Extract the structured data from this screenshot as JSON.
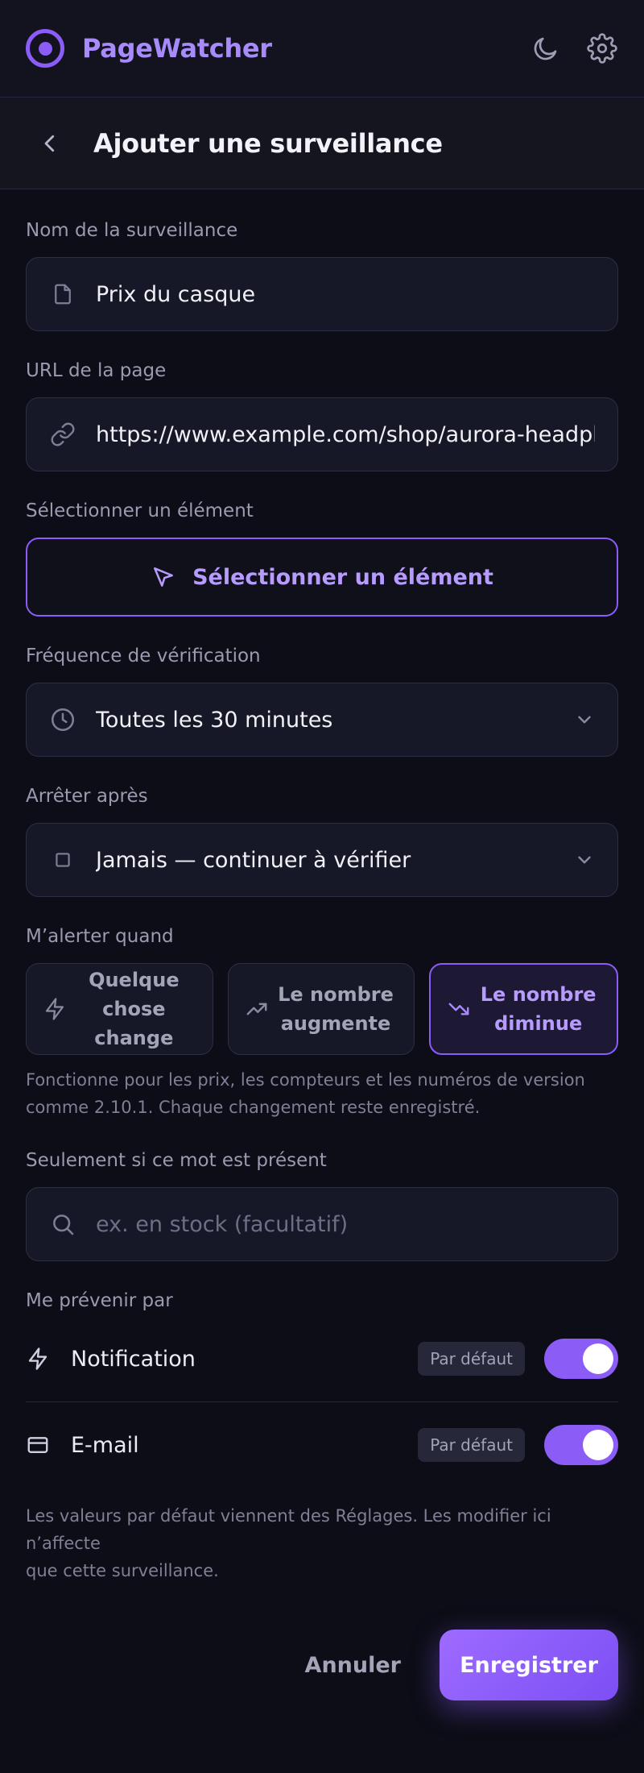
{
  "app": {
    "name": "PageWatcher"
  },
  "colors": {
    "accent": "#8b5cf6",
    "background": "#0c0d16",
    "surface": "#171827"
  },
  "icons": {
    "logo": "logo-icon",
    "theme": "moon-icon",
    "settings": "gear-icon",
    "back": "chevron-left-icon",
    "name_field": "file-icon",
    "url_field": "link-icon",
    "select_element": "cursor-icon",
    "frequency": "clock-icon",
    "stop_after": "square-icon",
    "chevron": "chevron-down-icon",
    "search": "search-icon",
    "notification": "bolt-icon",
    "email": "card-icon"
  },
  "header": {
    "title": "Ajouter une surveillance"
  },
  "form": {
    "name": {
      "label": "Nom de la surveillance",
      "value": "Prix du casque"
    },
    "url": {
      "label": "URL de la page",
      "value": "https://www.example.com/shop/aurora-headphones"
    },
    "element": {
      "label": "Sélectionner un élément",
      "button": "Sélectionner un élément"
    },
    "frequency": {
      "label": "Fréquence de vérification",
      "value": "Toutes les 30 minutes"
    },
    "stop_after": {
      "label": "Arrêter après",
      "value": "Jamais — continuer à vérifier"
    },
    "alert_when": {
      "label": "M’alerter quand",
      "selected": "Le nombre diminue",
      "options": [
        {
          "line1": "Quelque",
          "line2": "chose change"
        },
        {
          "line1": "Le nombre",
          "line2": "augmente"
        },
        {
          "line1": "Le nombre",
          "line2": "diminue"
        }
      ],
      "help_line1": "Fonctionne pour les prix, les compteurs et les numéros de version",
      "help_line2": "comme 2.10.1. Chaque changement reste enregistré."
    },
    "keyword": {
      "label": "Seulement si ce mot est présent",
      "placeholder": "ex. en stock (facultatif)"
    },
    "notify": {
      "label": "Me prévenir par",
      "channels": [
        {
          "label": "Notification",
          "badge": "Par défaut",
          "enabled": true
        },
        {
          "label": "E-mail",
          "badge": "Par défaut",
          "enabled": true
        }
      ],
      "note_line1": "Les valeurs par défaut viennent des Réglages. Les modifier ici n’affecte",
      "note_line2": "que cette surveillance."
    }
  },
  "actions": {
    "cancel": "Annuler",
    "save": "Enregistrer"
  }
}
